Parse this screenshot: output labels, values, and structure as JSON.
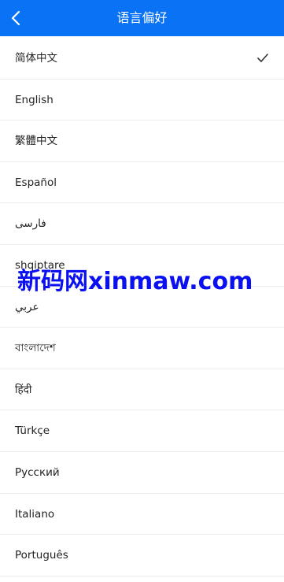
{
  "header": {
    "title": "语言偏好",
    "background": "#0a73f5",
    "back_icon": "chevron-left-icon"
  },
  "languages": [
    {
      "label": "简体中文",
      "selected": true
    },
    {
      "label": "English",
      "selected": false
    },
    {
      "label": "繁體中文",
      "selected": false
    },
    {
      "label": "Español",
      "selected": false
    },
    {
      "label": "فارسی",
      "selected": false
    },
    {
      "label": "shqiptare",
      "selected": false
    },
    {
      "label": "عربي",
      "selected": false
    },
    {
      "label": "বাংলাদেশ",
      "selected": false
    },
    {
      "label": "हिंदी",
      "selected": false
    },
    {
      "label": "Türkçe",
      "selected": false
    },
    {
      "label": "Русский",
      "selected": false
    },
    {
      "label": "Italiano",
      "selected": false
    },
    {
      "label": "Português",
      "selected": false
    }
  ],
  "watermark": {
    "text": "新码网xinmaw.com",
    "color": "#0b10f0"
  }
}
